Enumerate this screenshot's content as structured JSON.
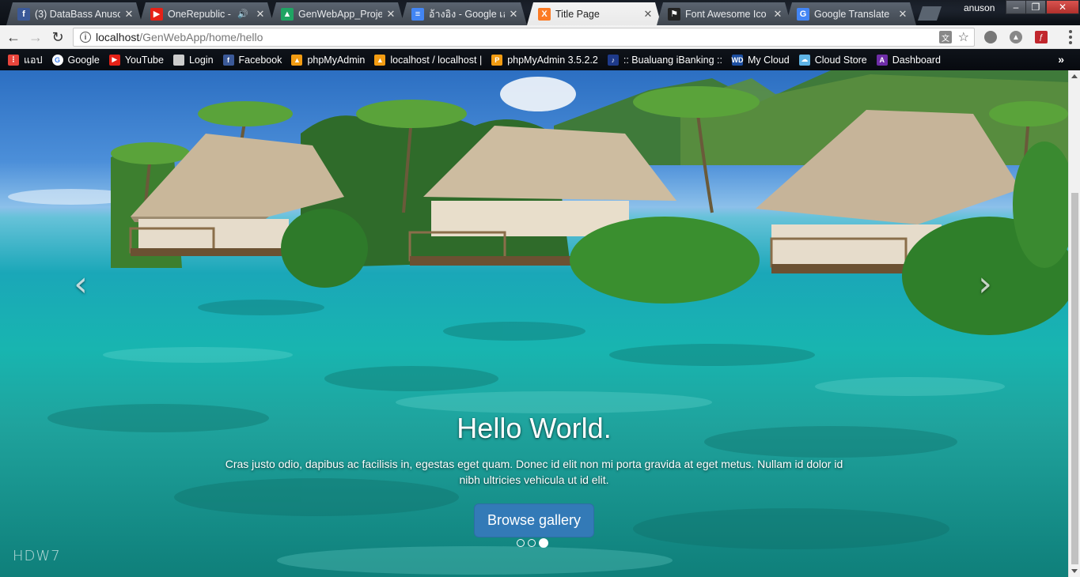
{
  "browser": {
    "tabs": [
      {
        "title": "(3) DataBass Anuso",
        "favicon": "facebook-icon",
        "favicon_text": "f",
        "favicon_color": "#3b5998",
        "active": false,
        "audio": false
      },
      {
        "title": "OneRepublic - ",
        "favicon": "youtube-icon",
        "favicon_text": "▶",
        "favicon_color": "#e62117",
        "active": false,
        "audio": true
      },
      {
        "title": "GenWebApp_Proje",
        "favicon": "google-drive-icon",
        "favicon_text": "▲",
        "favicon_color": "#1fa463",
        "active": false,
        "audio": false
      },
      {
        "title": "อ้างอิง - Google เอก",
        "favicon": "google-docs-icon",
        "favicon_text": "≡",
        "favicon_color": "#4285f4",
        "active": false,
        "audio": false
      },
      {
        "title": "Title Page",
        "favicon": "xampp-icon",
        "favicon_text": "X",
        "favicon_color": "#fb7a24",
        "active": true,
        "audio": false
      },
      {
        "title": "Font Awesome Ico",
        "favicon": "flag-icon",
        "favicon_text": "⚑",
        "favicon_color": "#222222",
        "active": false,
        "audio": false
      },
      {
        "title": "Google Translate",
        "favicon": "google-translate-icon",
        "favicon_text": "G",
        "favicon_color": "#4285f4",
        "active": false,
        "audio": false
      }
    ],
    "profile_name": "anuson",
    "window_buttons": {
      "minimize": "–",
      "maximize": "❐",
      "close": "✕"
    },
    "address": {
      "host": "localhost",
      "path": "/GenWebApp/home/hello"
    },
    "bookmarks": [
      {
        "label": "แอป",
        "icon": "apps-icon",
        "icon_color": "#e8453c",
        "icon_text": "⋮"
      },
      {
        "label": "Google",
        "icon": "google-icon",
        "icon_color": "#ffffff",
        "icon_text": "G"
      },
      {
        "label": "YouTube",
        "icon": "youtube-icon",
        "icon_color": "#e62117",
        "icon_text": "▶"
      },
      {
        "label": "Login",
        "icon": "page-icon",
        "icon_color": "#cccccc",
        "icon_text": ""
      },
      {
        "label": "Facebook",
        "icon": "facebook-icon",
        "icon_color": "#3b5998",
        "icon_text": "f"
      },
      {
        "label": "phpMyAdmin",
        "icon": "phpmyadmin-icon",
        "icon_color": "#f39c12",
        "icon_text": "▲"
      },
      {
        "label": "localhost / localhost |",
        "icon": "phpmyadmin-icon",
        "icon_color": "#f39c12",
        "icon_text": "▲"
      },
      {
        "label": "phpMyAdmin 3.5.2.2",
        "icon": "pma-icon",
        "icon_color": "#f39c12",
        "icon_text": "P"
      },
      {
        "label": ":: Bualuang iBanking ::",
        "icon": "bank-icon",
        "icon_color": "#1e3a8a",
        "icon_text": "♪"
      },
      {
        "label": "My Cloud",
        "icon": "wd-icon",
        "icon_color": "#1c4ea0",
        "icon_text": "WD"
      },
      {
        "label": "Cloud Store",
        "icon": "cloud-store-icon",
        "icon_color": "#5eb3e4",
        "icon_text": "☁"
      },
      {
        "label": "Dashboard",
        "icon": "dashboard-icon",
        "icon_color": "#6f2da8",
        "icon_text": "A"
      }
    ],
    "bookmarks_more": "»"
  },
  "carousel": {
    "heading": "Hello World.",
    "text": "Cras justo odio, dapibus ac facilisis in, egestas eget quam. Donec id elit non mi porta gravida at eget metus. Nullam id dolor id nibh ultricies vehicula ut id elit.",
    "button_label": "Browse gallery",
    "prev_glyph": "‹",
    "next_glyph": "›",
    "slide_count": 3,
    "active_slide": 3,
    "watermark": "HDW7"
  }
}
